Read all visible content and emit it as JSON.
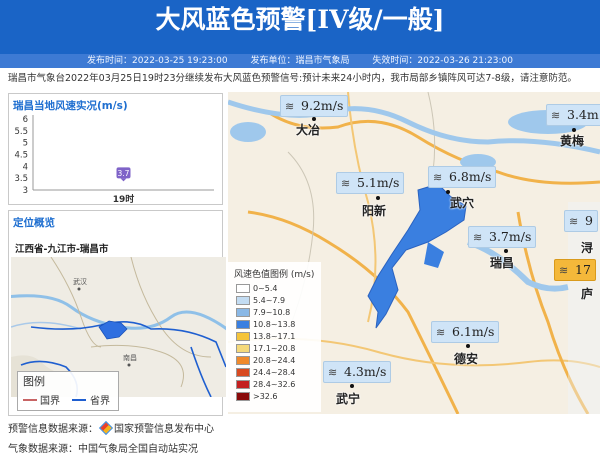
{
  "header": {
    "title": "大风蓝色预警[IV级/一般]",
    "issue_time": "发布时间：2022-03-25 19:23:00",
    "issuer": "发布单位：瑞昌市气象局",
    "expire_time": "失效时间：2022-03-26 21:23:00"
  },
  "description": "瑞昌市气象台2022年03月25日19时23分继续发布大风蓝色预警信号:预计未来24小时内，我市局部乡镇阵风可达7-8级，请注意防范。",
  "wind_panel": {
    "title": "瑞昌当地风速实况(m/s)",
    "chart_data": {
      "type": "scatter",
      "categories": [
        "19时"
      ],
      "values": [
        3.7
      ],
      "data_labels": [
        "3.7"
      ],
      "ylim": [
        3,
        6
      ],
      "yticks": [
        "6",
        "5.5",
        "5",
        "4.5",
        "4",
        "3.5",
        "3"
      ],
      "point_color": "#7f63c8"
    }
  },
  "location_panel": {
    "title": "定位概览",
    "region": "江西省-九江市-瑞昌市",
    "minimap_places": [
      "武汉",
      "南昌"
    ],
    "legend": {
      "title": "图例",
      "items": [
        {
          "label": "国界",
          "color": "#c86464"
        },
        {
          "label": "省界",
          "color": "#1f5fd0"
        }
      ]
    }
  },
  "map": {
    "wind_labels": [
      {
        "value": "9.2m/s",
        "style": "blue"
      },
      {
        "value": "5.1m/s",
        "style": "blue"
      },
      {
        "value": "6.8m/s",
        "style": "blue"
      },
      {
        "value": "3.7m/s",
        "style": "blue"
      },
      {
        "value": "6.1m/s",
        "style": "blue"
      },
      {
        "value": "4.3m/s",
        "style": "blue"
      },
      {
        "value": "3.4m",
        "style": "blue"
      },
      {
        "value": "9",
        "style": "blue"
      },
      {
        "value": "17",
        "style": "orange"
      }
    ],
    "cities": [
      "大冶",
      "阳新",
      "武穴",
      "瑞昌",
      "德安",
      "武宁",
      "黄梅",
      "浔",
      "庐"
    ],
    "scale": {
      "title": "风速色值图例 (m/s)",
      "items": [
        {
          "label": "0~5.4",
          "color": "#ffffff"
        },
        {
          "label": "5.4~7.9",
          "color": "#c3dcf2"
        },
        {
          "label": "7.9~10.8",
          "color": "#8ab8e6"
        },
        {
          "label": "10.8~13.8",
          "color": "#3a7fe0"
        },
        {
          "label": "13.8~17.1",
          "color": "#f5c43a"
        },
        {
          "label": "17.1~20.8",
          "color": "#f5d97a"
        },
        {
          "label": "20.8~24.4",
          "color": "#f08a2c"
        },
        {
          "label": "24.4~28.4",
          "color": "#d84a20"
        },
        {
          "label": "28.4~32.6",
          "color": "#c42020"
        },
        {
          "label": ">32.6",
          "color": "#8a0a0a"
        }
      ]
    }
  },
  "footer": {
    "warning_source_label": "预警信息数据来源：",
    "warning_source": "国家预警信息发布中心",
    "weather_source": "气象数据来源：中国气象局全国自动站实况"
  }
}
